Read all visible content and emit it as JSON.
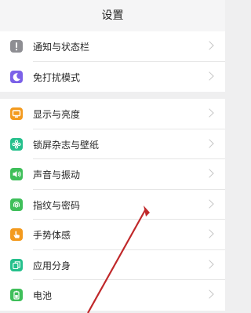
{
  "header": {
    "title": "设置"
  },
  "group1": [
    {
      "label": "通知与状态栏",
      "icon": "exclamation-icon",
      "color": "#8e8e93"
    },
    {
      "label": "免打扰模式",
      "icon": "moon-icon",
      "color": "#7b61e8"
    }
  ],
  "group2": [
    {
      "label": "显示与亮度",
      "icon": "display-icon",
      "color": "#f39a1e"
    },
    {
      "label": "锁屏杂志与壁纸",
      "icon": "flower-icon",
      "color": "#25c08c"
    },
    {
      "label": "声音与振动",
      "icon": "speaker-icon",
      "color": "#3fbf5a"
    },
    {
      "label": "指纹与密码",
      "icon": "fingerprint-icon",
      "color": "#3fbf5a"
    },
    {
      "label": "手势体感",
      "icon": "hand-icon",
      "color": "#f39a1e"
    },
    {
      "label": "应用分身",
      "icon": "clone-icon",
      "color": "#25c08c"
    },
    {
      "label": "电池",
      "icon": "battery-icon",
      "color": "#3fbf5a"
    }
  ],
  "annotation_arrow_color": "#c0282a"
}
